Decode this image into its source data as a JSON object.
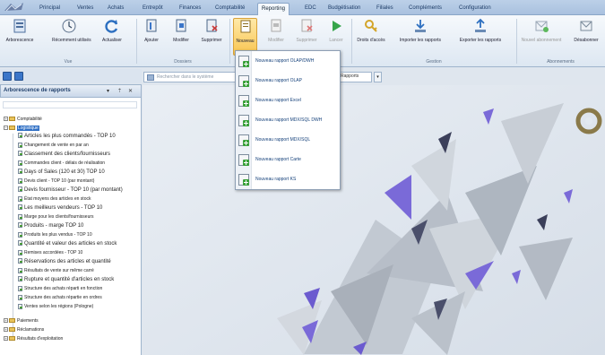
{
  "tabs": [
    "Principal",
    "Ventes",
    "Achats",
    "Entrepôt",
    "Finances",
    "Comptabilité",
    "Reporting",
    "EDC",
    "Budgétisation",
    "Filiales",
    "Compléments",
    "Configuration"
  ],
  "active_tab": "Reporting",
  "ribbon": {
    "buttons": [
      {
        "id": "arborescence",
        "label": "Arborescence"
      },
      {
        "id": "recemment",
        "label": "Récemment utilisés"
      },
      {
        "id": "actualiser",
        "label": "Actualiser"
      },
      {
        "id": "ajouter",
        "label": "Ajouter"
      },
      {
        "id": "modifier",
        "label": "Modifier"
      },
      {
        "id": "supprimer",
        "label": "Supprimer"
      },
      {
        "id": "nouveau",
        "label": "Nouveau"
      },
      {
        "id": "modifier2",
        "label": "Modifier"
      },
      {
        "id": "supprimer2",
        "label": "Supprimer"
      },
      {
        "id": "lancer",
        "label": "Lancer"
      },
      {
        "id": "droits",
        "label": "Droits d'accès"
      },
      {
        "id": "importer",
        "label": "Importer les rapports"
      },
      {
        "id": "exporter",
        "label": "Exporter les rapports"
      },
      {
        "id": "nouvel-abonnement",
        "label": "Nouvel abonnement"
      },
      {
        "id": "desabonner",
        "label": "Désabonner"
      }
    ],
    "groups": [
      "Vue",
      "Dossiers",
      "Gestion",
      "Abonnements"
    ]
  },
  "panel": {
    "title": "Arborescence de rapports",
    "controls": [
      "▾",
      "⇡",
      "✕"
    ]
  },
  "search": {
    "placeholder": "Rechercher dans le système",
    "side_label": "Rapports"
  },
  "tree": {
    "root": [
      {
        "label": "Comptabilité"
      },
      {
        "label": "Logistique"
      }
    ],
    "items": [
      {
        "label": "Articles les plus commandés - TOP 10",
        "big": true
      },
      {
        "label": "Changement de vente en par an",
        "big": false
      },
      {
        "label": "Classement des clients/fournisseurs",
        "big": true
      },
      {
        "label": "Commandes client - délais de réalisation",
        "big": false
      },
      {
        "label": "Days of Sales (120 et 30) TOP 10",
        "big": true
      },
      {
        "label": "Devis client - TOP 10 (par montant)",
        "big": false
      },
      {
        "label": "Devis fournisseur - TOP 10 (par montant)",
        "big": true
      },
      {
        "label": "État moyens des articles en stock",
        "big": false
      },
      {
        "label": "Les meilleurs vendeurs - TOP 10",
        "big": true
      },
      {
        "label": "Marge pour les clients/fournisseurs",
        "big": false
      },
      {
        "label": "Produits - marge TOP 10",
        "big": true
      },
      {
        "label": "Produits les plus vendus - TOP 10",
        "big": false
      },
      {
        "label": "Quantité et valeur des articles en stock",
        "big": true
      },
      {
        "label": "Remises accordées - TOP 10",
        "big": false
      },
      {
        "label": "Réservations des articles et quantité",
        "big": true
      },
      {
        "label": "Résultats de vente sur même carré",
        "big": false
      },
      {
        "label": "Rupture et quantité d'articles en stock",
        "big": true
      },
      {
        "label": "Structure des achats réparti en fonction",
        "big": false
      },
      {
        "label": "Structure des achats répartie en ordres",
        "big": false
      },
      {
        "label": "Ventes selon les régions (Pologne)",
        "big": false
      }
    ],
    "tail": [
      {
        "label": "Paiements"
      },
      {
        "label": "Réclamations"
      },
      {
        "label": "Résultats d'exploitation"
      }
    ]
  },
  "menu": {
    "items": [
      "Nouveau rapport OLAP/DWH",
      "Nouveau rapport OLAP",
      "Nouveau rapport Excel",
      "Nouveau rapport MDX/SQL DWH",
      "Nouveau rapport MDX/SQL",
      "Nouveau rapport Carte",
      "Nouveau rapport KS"
    ]
  }
}
